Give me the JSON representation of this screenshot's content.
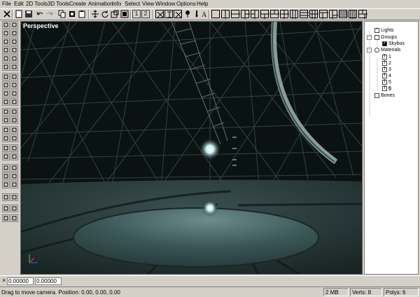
{
  "menu": [
    "File",
    "Edit",
    "2D Tools",
    "3D Tools",
    "Create",
    "Animation",
    "Info",
    "Select",
    "View",
    "Window",
    "Options",
    "Help"
  ],
  "toolbar": {
    "buttons": [
      "close-icon",
      "new-icon",
      "save-icon",
      "undo-icon",
      "redo-icon",
      "copy-icon",
      "cut-icon",
      "paste-icon",
      "move-icon",
      "rotate-icon",
      "scale-icon",
      "select-box-icon",
      "select-face-icon"
    ],
    "layer1": "1",
    "layer2": "2",
    "view_buttons": [
      "grid-icon",
      "snap-icon",
      "axis-icon",
      "texture-icon",
      "light-icon",
      "brush-icon",
      "font-icon",
      "layout-icons"
    ]
  },
  "viewport": {
    "label": "Perspective"
  },
  "tree": {
    "items": [
      {
        "label": "Lights",
        "level": 1
      },
      {
        "label": "Groups",
        "level": 1
      },
      {
        "label": "Skybox",
        "level": 2
      },
      {
        "label": "Materials",
        "level": 1
      },
      {
        "label": "1",
        "level": 2
      },
      {
        "label": "2",
        "level": 2
      },
      {
        "label": "3",
        "level": 2
      },
      {
        "label": "4",
        "level": 2
      },
      {
        "label": "5",
        "level": 2
      },
      {
        "label": "6",
        "level": 2
      },
      {
        "label": "Bones",
        "level": 1
      }
    ]
  },
  "coords": {
    "x": "0.00000",
    "y": "0.00000"
  },
  "status": {
    "message": "Drag to move camera. Position: 0.00, 0.00, 0.00",
    "memory": "2 MB",
    "verts": "Verts: 8",
    "polys": "Polys: 6"
  }
}
